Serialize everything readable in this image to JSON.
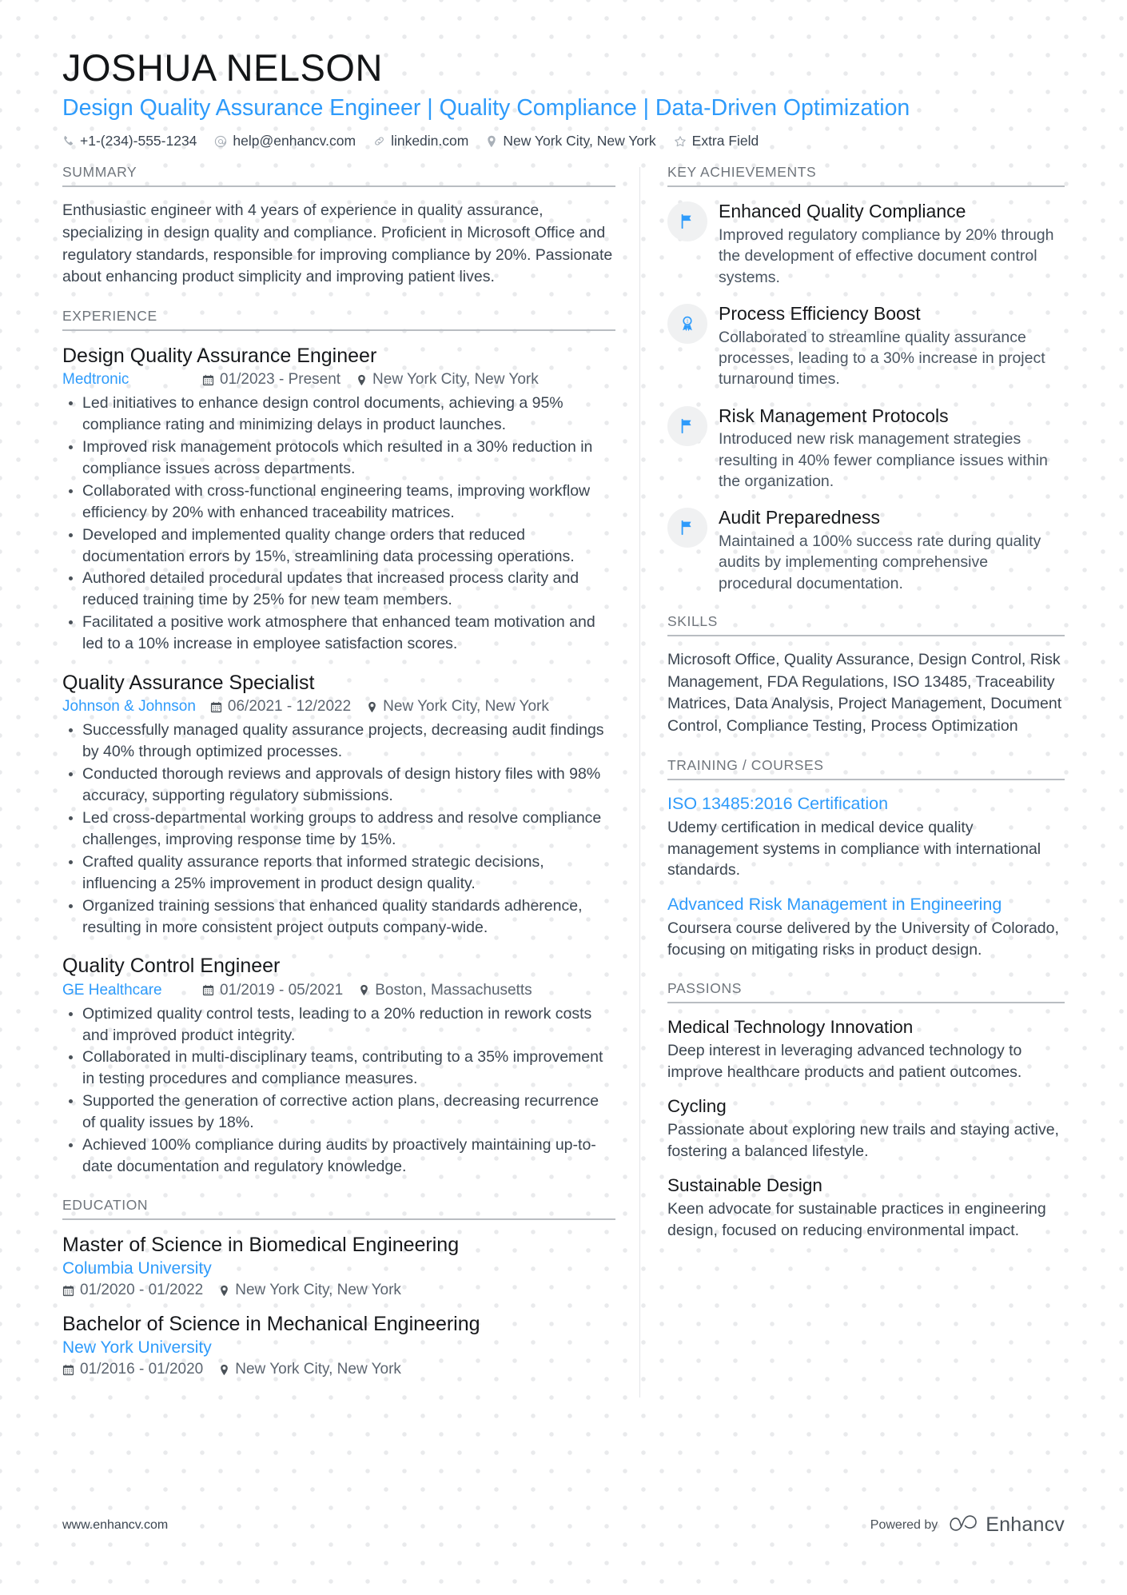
{
  "header": {
    "name": "JOSHUA NELSON",
    "headline": "Design Quality Assurance Engineer | Quality Compliance | Data-Driven Optimization",
    "contacts": [
      {
        "icon": "phone-icon",
        "text": "+1-(234)-555-1234"
      },
      {
        "icon": "email-icon",
        "text": "help@enhancv.com"
      },
      {
        "icon": "link-icon",
        "text": "linkedin.com"
      },
      {
        "icon": "location-icon",
        "text": "New York City, New York"
      },
      {
        "icon": "star-icon",
        "text": "Extra Field"
      }
    ]
  },
  "summary": {
    "heading": "SUMMARY",
    "text": "Enthusiastic engineer with 4 years of experience in quality assurance, specializing in design quality and compliance. Proficient in Microsoft Office and regulatory standards, responsible for improving compliance by 20%. Passionate about enhancing product simplicity and improving patient lives."
  },
  "experience": {
    "heading": "EXPERIENCE",
    "jobs": [
      {
        "title": "Design Quality Assurance Engineer",
        "company": "Medtronic",
        "dates": "01/2023 - Present",
        "location": "New York City, New York",
        "bullets": [
          "Led initiatives to enhance design control documents, achieving a 95% compliance rating and minimizing delays in product launches.",
          "Improved risk management protocols which resulted in a 30% reduction in compliance issues across departments.",
          "Collaborated with cross-functional engineering teams, improving workflow efficiency by 20% with enhanced traceability matrices.",
          "Developed and implemented quality change orders that reduced documentation errors by 15%, streamlining data processing operations.",
          "Authored detailed procedural updates that increased process clarity and reduced training time by 25% for new team members.",
          "Facilitated a positive work atmosphere that enhanced team motivation and led to a 10% increase in employee satisfaction scores."
        ]
      },
      {
        "title": "Quality Assurance Specialist",
        "company": "Johnson & Johnson",
        "dates": "06/2021 - 12/2022",
        "location": "New York City, New York",
        "bullets": [
          "Successfully managed quality assurance projects, decreasing audit findings by 40% through optimized processes.",
          "Conducted thorough reviews and approvals of design history files with 98% accuracy, supporting regulatory submissions.",
          "Led cross-departmental working groups to address and resolve compliance challenges, improving response time by 15%.",
          "Crafted quality assurance reports that informed strategic decisions, influencing a 25% improvement in product design quality.",
          "Organized training sessions that enhanced quality standards adherence, resulting in more consistent project outputs company-wide."
        ]
      },
      {
        "title": "Quality Control Engineer",
        "company": "GE Healthcare",
        "dates": "01/2019 - 05/2021",
        "location": "Boston, Massachusetts",
        "bullets": [
          "Optimized quality control tests, leading to a 20% reduction in rework costs and improved product integrity.",
          "Collaborated in multi-disciplinary teams, contributing to a 35% improvement in testing procedures and compliance measures.",
          "Supported the generation of corrective action plans, decreasing recurrence of quality issues by 18%.",
          "Achieved 100% compliance during audits by proactively maintaining up-to-date documentation and regulatory knowledge."
        ]
      }
    ]
  },
  "education": {
    "heading": "EDUCATION",
    "entries": [
      {
        "degree": "Master of Science in Biomedical Engineering",
        "school": "Columbia University",
        "dates": "01/2020 - 01/2022",
        "location": "New York City, New York"
      },
      {
        "degree": "Bachelor of Science in Mechanical Engineering",
        "school": "New York University",
        "dates": "01/2016 - 01/2020",
        "location": "New York City, New York"
      }
    ]
  },
  "achievements": {
    "heading": "KEY ACHIEVEMENTS",
    "items": [
      {
        "icon": "flag-icon",
        "title": "Enhanced Quality Compliance",
        "desc": "Improved regulatory compliance by 20% through the development of effective document control systems."
      },
      {
        "icon": "award-ribbon-icon",
        "title": "Process Efficiency Boost",
        "desc": "Collaborated to streamline quality assurance processes, leading to a 30% increase in project turnaround times."
      },
      {
        "icon": "flag-icon",
        "title": "Risk Management Protocols",
        "desc": "Introduced new risk management strategies resulting in 40% fewer compliance issues within the organization."
      },
      {
        "icon": "flag-icon",
        "title": "Audit Preparedness",
        "desc": "Maintained a 100% success rate during quality audits by implementing comprehensive procedural documentation."
      }
    ]
  },
  "skills": {
    "heading": "SKILLS",
    "text": "Microsoft Office, Quality Assurance, Design Control, Risk Management, FDA Regulations, ISO 13485, Traceability Matrices, Data Analysis, Project Management, Document Control, Compliance Testing, Process Optimization"
  },
  "courses": {
    "heading": "TRAINING / COURSES",
    "items": [
      {
        "title": "ISO 13485:2016 Certification",
        "desc": "Udemy certification in medical device quality management systems in compliance with international standards."
      },
      {
        "title": "Advanced Risk Management in Engineering",
        "desc": "Coursera course delivered by the University of Colorado, focusing on mitigating risks in product design."
      }
    ]
  },
  "passions": {
    "heading": "PASSIONS",
    "items": [
      {
        "title": "Medical Technology Innovation",
        "desc": "Deep interest in leveraging advanced technology to improve healthcare products and patient outcomes."
      },
      {
        "title": "Cycling",
        "desc": "Passionate about exploring new trails and staying active, fostering a balanced lifestyle."
      },
      {
        "title": "Sustainable Design",
        "desc": "Keen advocate for sustainable practices in engineering design, focused on reducing environmental impact."
      }
    ]
  },
  "footer": {
    "url": "www.enhancv.com",
    "powered_by": "Powered by",
    "brand": "Enhancv"
  },
  "colors": {
    "accent": "#2e9bfb",
    "heading_gray": "#6f757c",
    "body_text": "#3b4550",
    "rule": "#b9bdc2",
    "icon_bubble": "#f0f1f2",
    "dot_pattern": "#e9eaec"
  }
}
